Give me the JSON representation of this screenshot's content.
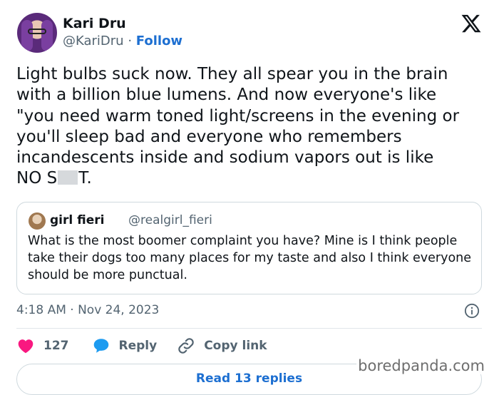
{
  "author": {
    "display_name": "Kari Dru",
    "handle": "@KariDru",
    "separator": "·",
    "follow_label": "Follow"
  },
  "tweet": {
    "text_main": "Light bulbs suck now. They all spear you in the brain\nwith a billion blue lumens. And now everyone's like\n\"you need warm toned light/screens in the evening or\nyou'll sleep bad and everyone who remembers\nincandescents inside and sodium vapors out is like\nNO S",
    "text_tail": "T.",
    "timestamp": "4:18 AM · Nov 24, 2023"
  },
  "quote": {
    "name": "girl fieri",
    "handle": "@realgirl_fieri",
    "text": "What is the most boomer complaint you have? Mine is I think people take their dogs too many places for my taste and also I think everyone should be more punctual."
  },
  "actions": {
    "like_count": "127",
    "reply_label": "Reply",
    "copy_label": "Copy link"
  },
  "read_replies_label": "Read 13 replies",
  "watermark": "boredpanda.com",
  "colors": {
    "like": "#f91880",
    "reply": "#1d9bf0",
    "link": "#1d6fd1",
    "muted": "#536471"
  },
  "icons": [
    "x-logo-icon",
    "info-icon",
    "heart-icon",
    "reply-bubble-icon",
    "link-icon"
  ]
}
